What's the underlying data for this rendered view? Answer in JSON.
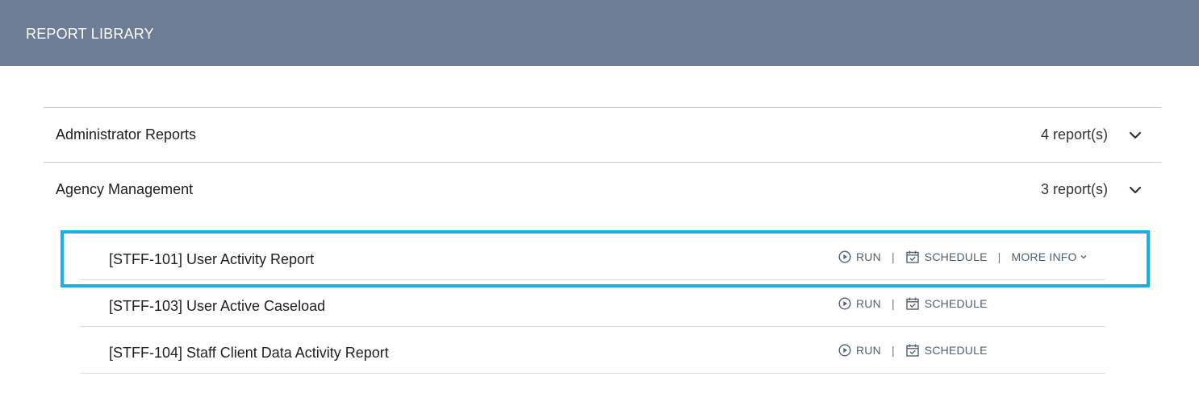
{
  "header": {
    "title": "REPORT LIBRARY",
    "background": "#6e7d95"
  },
  "groups": [
    {
      "name": "Administrator Reports",
      "count": "4 report(s)"
    },
    {
      "name": "Agency Management",
      "count": "3 report(s)"
    }
  ],
  "reports": [
    {
      "title": "[STFF-101] User Activity Report",
      "run": "RUN",
      "separator": "|",
      "schedule": "SCHEDULE",
      "more_info": "MORE INFO"
    },
    {
      "title": "[STFF-103] User Active Caseload",
      "run": "RUN",
      "separator": "|",
      "schedule": "SCHEDULE"
    },
    {
      "title": "[STFF-104] Staff Client Data Activity Report",
      "run": "RUN",
      "separator": "|",
      "schedule": "SCHEDULE"
    }
  ],
  "icons": {
    "run": "play-circle-icon",
    "schedule": "calendar-check-icon",
    "expand": "chevron-down-icon"
  },
  "colors": {
    "highlight": "#12b1e8",
    "action_text": "#555d6e"
  }
}
